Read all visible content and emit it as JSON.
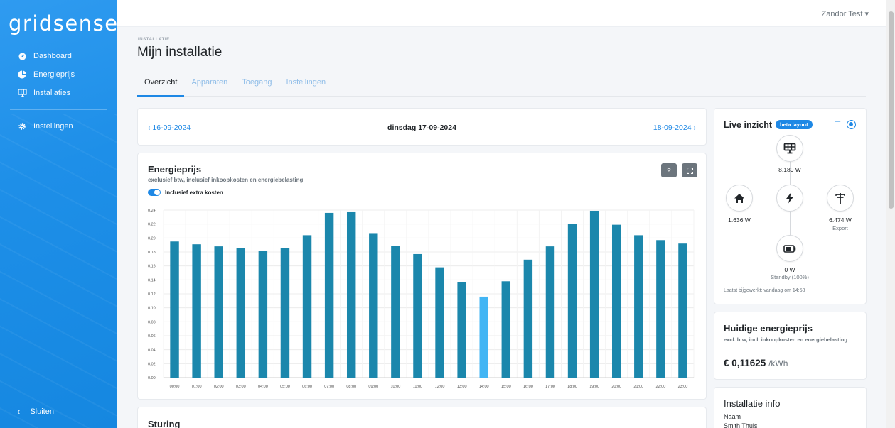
{
  "sidebar": {
    "logo": "gridsense",
    "items": [
      {
        "label": "Dashboard",
        "icon": "gauge-icon"
      },
      {
        "label": "Energieprijs",
        "icon": "pie-chart-icon"
      },
      {
        "label": "Installaties",
        "icon": "solar-panel-icon"
      },
      {
        "label": "Instellingen",
        "icon": "gear-icon"
      }
    ],
    "close_label": "Sluiten"
  },
  "topbar": {
    "user": "Zandor Test ▾"
  },
  "header": {
    "pretitle": "INSTALLATIE",
    "title": "Mijn installatie"
  },
  "tabs": [
    {
      "label": "Overzicht",
      "active": true
    },
    {
      "label": "Apparaten",
      "active": false
    },
    {
      "label": "Toegang",
      "active": false
    },
    {
      "label": "Instellingen",
      "active": false
    }
  ],
  "datenav": {
    "prev": "16-09-2024",
    "current": "dinsdag 17-09-2024",
    "next": "18-09-2024"
  },
  "energy_card": {
    "title": "Energieprijs",
    "subtitle": "exclusief btw, inclusief inkoopkosten en energiebelasting",
    "toggle_label": "Inclusief extra kosten",
    "help_label": "?",
    "fullscreen_label": "⛶"
  },
  "chart_data": {
    "type": "bar",
    "categories": [
      "00:00",
      "01:00",
      "02:00",
      "03:00",
      "04:00",
      "05:00",
      "06:00",
      "07:00",
      "08:00",
      "09:00",
      "10:00",
      "11:00",
      "12:00",
      "13:00",
      "14:00",
      "15:00",
      "16:00",
      "17:00",
      "18:00",
      "19:00",
      "20:00",
      "21:00",
      "22:00",
      "23:00"
    ],
    "values": [
      0.195,
      0.191,
      0.188,
      0.186,
      0.182,
      0.186,
      0.204,
      0.236,
      0.238,
      0.207,
      0.189,
      0.177,
      0.158,
      0.137,
      0.116,
      0.138,
      0.169,
      0.188,
      0.22,
      0.239,
      0.219,
      0.204,
      0.197,
      0.192
    ],
    "highlight_index": 14,
    "ylim": [
      0,
      0.24
    ],
    "yticks": [
      "0.00",
      "0.02",
      "0.04",
      "0.06",
      "0.08",
      "0.10",
      "0.12",
      "0.14",
      "0.16",
      "0.18",
      "0.20",
      "0.22",
      "0.24"
    ],
    "grid": true,
    "colors": {
      "bar": "#1b87ac",
      "highlight": "#42b5f4"
    }
  },
  "sturing": {
    "title": "Sturing"
  },
  "live": {
    "title": "Live inzicht",
    "beta": "beta layout",
    "solar": {
      "value": "8.189 W",
      "icon": "solar-panel-icon"
    },
    "home": {
      "value": "1.636 W",
      "icon": "home-icon"
    },
    "center": {
      "icon": "bolt-icon"
    },
    "grid": {
      "value": "6.474 W",
      "sub": "Export",
      "icon": "power-pole-icon"
    },
    "battery": {
      "value": "0 W",
      "sub": "Standby (100%)",
      "icon": "battery-icon"
    },
    "updated": "Laatst bijgewerkt: vandaag om 14:58"
  },
  "price": {
    "title": "Huidige energieprijs",
    "subtitle": "excl. btw, incl. inkoopkosten en energiebelasting",
    "value": "€ 0,11625",
    "unit": "/kWh"
  },
  "info": {
    "title": "Installatie info",
    "label": "Naam",
    "value": "Smith Thuis"
  },
  "colors": {
    "primary": "#1e88e5",
    "sidebar": "#1e8fe8"
  }
}
